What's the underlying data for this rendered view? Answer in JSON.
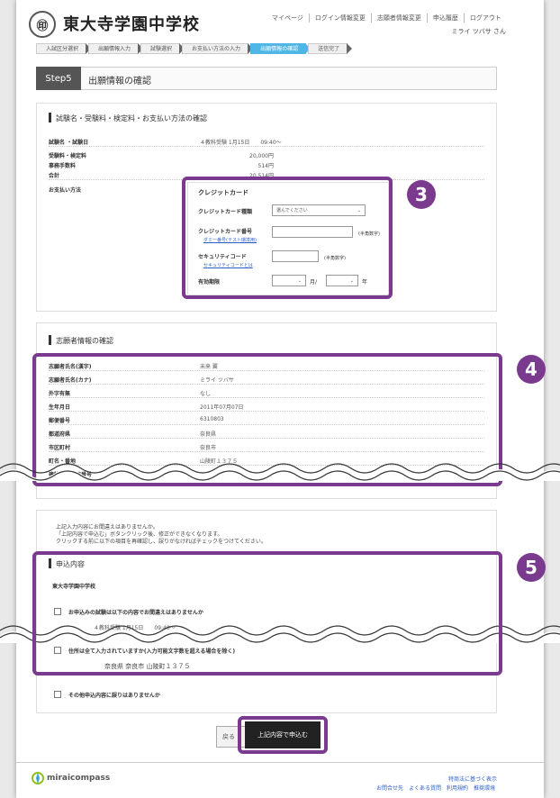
{
  "header": {
    "logo_glyph": "㊞",
    "school_name": "東大寺学園中学校",
    "nav": [
      "マイページ",
      "ログイン情報変更",
      "志願者情報変更",
      "申込履歴",
      "ログアウト"
    ],
    "user": "ミライ ツバサ さん"
  },
  "steps": [
    "入試区分選択",
    "出願情報入力",
    "試験選択",
    "お支払い方法の入力",
    "出願情報の確認",
    "送信完了"
  ],
  "step_label": "Step5",
  "step_title": "出願情報の確認",
  "exam_section": {
    "title": "試験名・受験料・検定料・お支払い方法の確認",
    "rows": [
      {
        "label": "試験名 ・試験日",
        "value": "４教科受験 1月15日　　09:40～"
      },
      {
        "label": "受験料・検定料",
        "value": "20,000円"
      },
      {
        "label": "事務手数料",
        "value": "514円"
      },
      {
        "label": "合計",
        "value": "20,514円"
      },
      {
        "label": "お支払い方法",
        "value": ""
      }
    ]
  },
  "payment": {
    "method": "クレジットカード",
    "card_type_label": "クレジットカード種類",
    "card_type_placeholder": "選んでください",
    "card_number_label": "クレジットカード番号",
    "card_number_note": "(半角数字)",
    "dummy_link": "ダミー番号(テスト環境用)",
    "security_label": "セキュリティコード",
    "security_note": "(半角数字)",
    "security_link": "セキュリティコードとは",
    "expiry_label": "有効期限",
    "month_unit": "月/",
    "year_unit": "年"
  },
  "applicant_section": {
    "title": "志願者情報の確認",
    "rows": [
      {
        "label": "志願者氏名(漢字)",
        "value": "未来 翼"
      },
      {
        "label": "志願者氏名(カナ)",
        "value": "ミライ ツバサ"
      },
      {
        "label": "外字有無",
        "value": "なし"
      },
      {
        "label": "生年月日",
        "value": "2011年07月07日"
      },
      {
        "label": "郵便番号",
        "value": "6310803"
      },
      {
        "label": "都道府県",
        "value": "奈良県"
      },
      {
        "label": "市区町村",
        "value": "奈良市"
      },
      {
        "label": "町名・番地",
        "value": "山陵町１３７５"
      },
      {
        "label": "建物名・部屋番号",
        "value": ""
      }
    ]
  },
  "notice": [
    "上記入力内容にお間違えはありませんか。",
    "「上記内容で申込む」ボタンクリック後、修正ができなくなります。",
    "クリックする前に以下の項目を再確認し、誤りがなければチェックをつけてください。"
  ],
  "apply_section": {
    "title": "申込内容",
    "school": "東大寺学園中学校",
    "check1": "お申込みの試験は以下の内容でお間違えはありませんか",
    "check1_detail": "４教科受験 1月15日　　09:40～",
    "check2": "住所は全て入力されていますか(入力可能文字数を超える場合を除く)",
    "check2_detail": "奈良県 奈良市 山陵町１３７５",
    "check3": "その他申込内容に誤りはありませんか"
  },
  "buttons": {
    "back": "戻る",
    "submit": "上記内容で申込む"
  },
  "badges": [
    "3",
    "4",
    "5"
  ],
  "footer": {
    "brand": "miraicompass",
    "links": [
      "お問合せ先",
      "よくある質問",
      "利用規約",
      "推奨環境"
    ],
    "law": "特商法に基づく表示"
  },
  "colors": {
    "highlight": "#7a3a8e",
    "active_step": "#4fb7e6"
  }
}
